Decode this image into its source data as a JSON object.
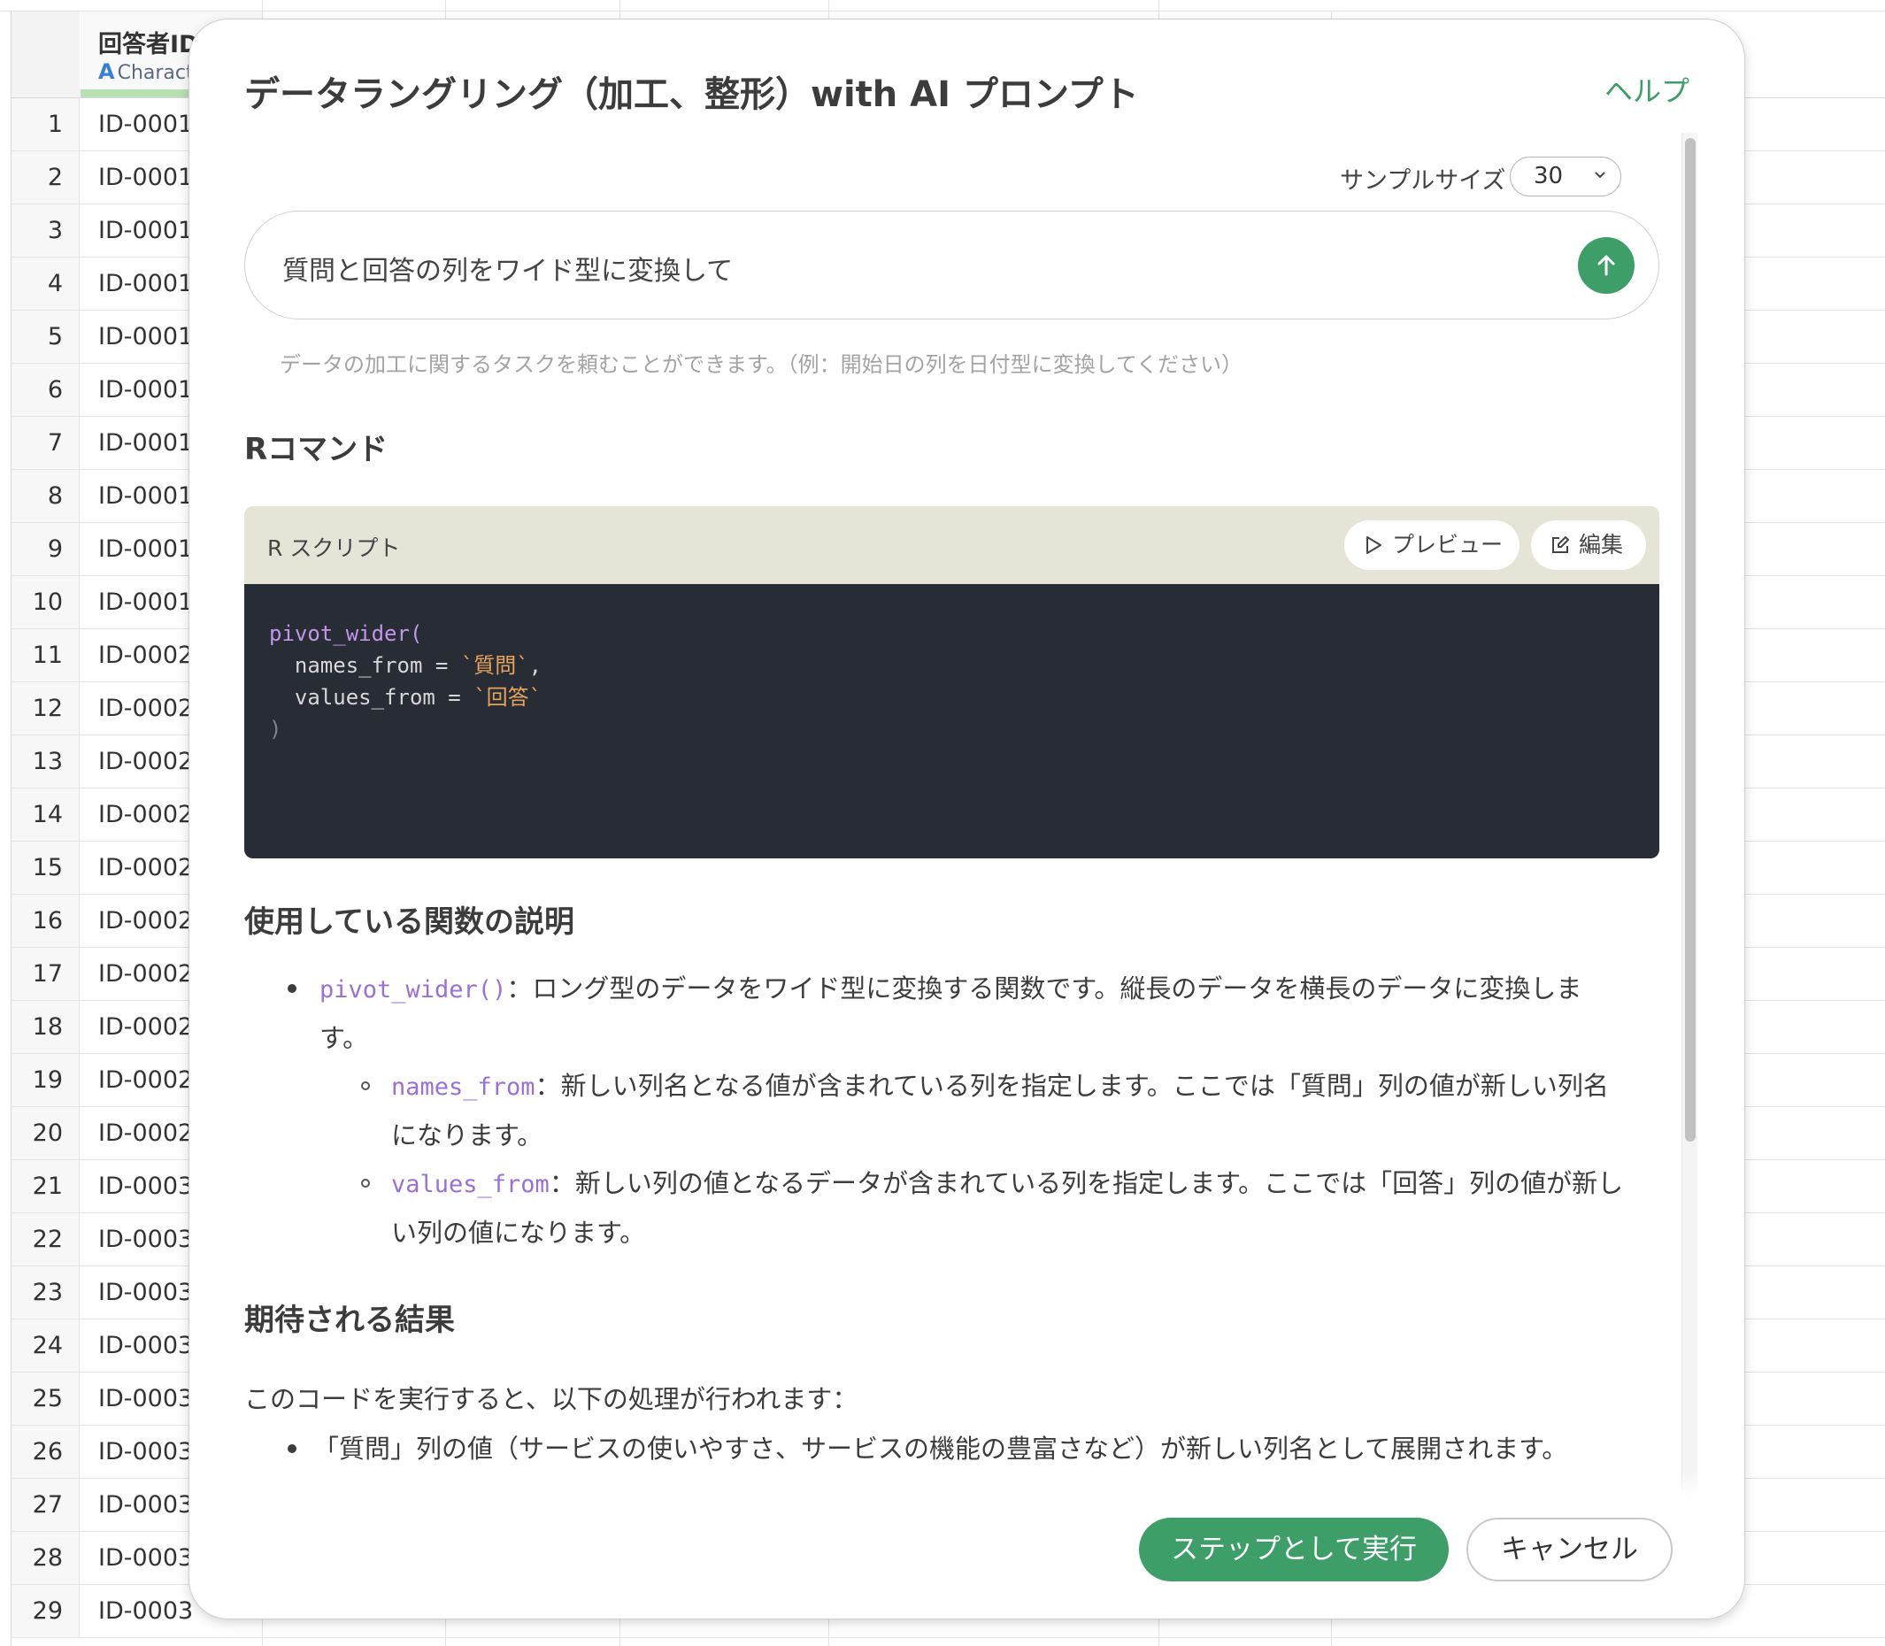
{
  "spreadsheet": {
    "column_name": "回答者ID",
    "column_type": "Charact",
    "column_type_icon": "A",
    "rows": [
      {
        "num": "1",
        "id": "ID-0001"
      },
      {
        "num": "2",
        "id": "ID-0001"
      },
      {
        "num": "3",
        "id": "ID-0001"
      },
      {
        "num": "4",
        "id": "ID-0001"
      },
      {
        "num": "5",
        "id": "ID-0001"
      },
      {
        "num": "6",
        "id": "ID-0001"
      },
      {
        "num": "7",
        "id": "ID-0001"
      },
      {
        "num": "8",
        "id": "ID-0001"
      },
      {
        "num": "9",
        "id": "ID-0001"
      },
      {
        "num": "10",
        "id": "ID-0001"
      },
      {
        "num": "11",
        "id": "ID-0002"
      },
      {
        "num": "12",
        "id": "ID-0002"
      },
      {
        "num": "13",
        "id": "ID-0002"
      },
      {
        "num": "14",
        "id": "ID-0002"
      },
      {
        "num": "15",
        "id": "ID-0002"
      },
      {
        "num": "16",
        "id": "ID-0002"
      },
      {
        "num": "17",
        "id": "ID-0002"
      },
      {
        "num": "18",
        "id": "ID-0002"
      },
      {
        "num": "19",
        "id": "ID-0002"
      },
      {
        "num": "20",
        "id": "ID-0002"
      },
      {
        "num": "21",
        "id": "ID-0003"
      },
      {
        "num": "22",
        "id": "ID-0003"
      },
      {
        "num": "23",
        "id": "ID-0003"
      },
      {
        "num": "24",
        "id": "ID-0003"
      },
      {
        "num": "25",
        "id": "ID-0003"
      },
      {
        "num": "26",
        "id": "ID-0003"
      },
      {
        "num": "27",
        "id": "ID-0003"
      },
      {
        "num": "28",
        "id": "ID-0003"
      },
      {
        "num": "29",
        "id": "ID-0003"
      }
    ]
  },
  "modal": {
    "title": "データラングリング（加工、整形）with AI プロンプト",
    "help_label": "ヘルプ",
    "sample_size_label": "サンプルサイズ",
    "sample_size_value": "30",
    "prompt_text": "質問と回答の列をワイド型に変換して",
    "hint": "データの加工に関するタスクを頼むことができます。（例：開始日の列を日付型に変換してください）",
    "r_command_heading": "Rコマンド",
    "code_card": {
      "label": "R スクリプト",
      "preview_label": "プレビュー",
      "edit_label": "編集",
      "fn_name": "pivot_wider(",
      "arg1_name": "  names_from = ",
      "arg1_value": "`質問`",
      "arg1_comma": ",",
      "arg2_name": "  values_from = ",
      "arg2_value": "`回答`",
      "close_paren": ")"
    },
    "functions_heading": "使用している関数の説明",
    "func_main_code": "pivot_wider()",
    "func_main_text_1": "：ロング型のデータをワイド型に変換する関数です。縦長のデータを横長のデータに変換しま",
    "func_main_text_2": "す。",
    "func_sub1_code": "names_from",
    "func_sub1_text_1": "：新しい列名となる値が含まれている列を指定します。ここでは「質問」列の値が新しい列名",
    "func_sub1_text_2": "になります。",
    "func_sub2_code": "values_from",
    "func_sub2_text_1": "：新しい列の値となるデータが含まれている列を指定します。ここでは「回答」列の値が新し",
    "func_sub2_text_2": "い列の値になります。",
    "result_heading": "期待される結果",
    "result_intro": "このコードを実行すると、以下の処理が行われます：",
    "result_bullet_1": "「質問」列の値（サービスの使いやすさ、サービスの機能の豊富さなど）が新しい列名として展開されます。",
    "run_label": "ステップとして実行",
    "cancel_label": "キャンセル"
  },
  "colors": {
    "accent_green": "#3d9e68",
    "code_bg": "#282c34",
    "code_header_bg": "#e6e3d7",
    "code_function": "#c096ea",
    "code_string": "#e5a35b"
  }
}
